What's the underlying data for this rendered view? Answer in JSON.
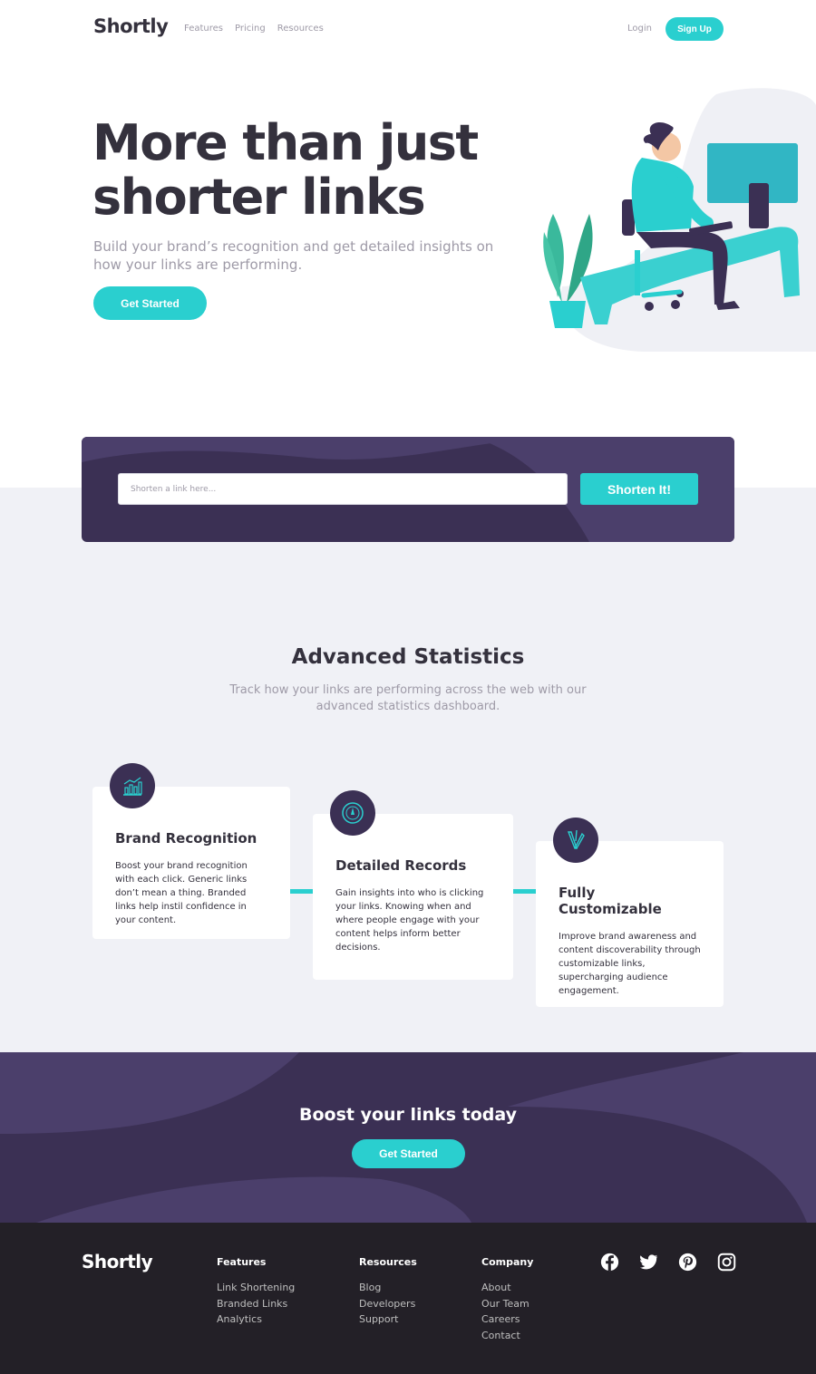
{
  "nav": {
    "logo": "Shortly",
    "links": [
      "Features",
      "Pricing",
      "Resources"
    ],
    "login": "Login",
    "signup": "Sign Up"
  },
  "hero": {
    "title_line1": "More than just",
    "title_line2": "shorter links",
    "subtitle": "Build your brand’s recognition and get detailed insights on how your links are performing.",
    "cta": "Get Started",
    "illustration": "person-working-at-desk-illustration"
  },
  "shorten": {
    "placeholder": "Shorten a link here...",
    "button": "Shorten It!"
  },
  "stats": {
    "title": "Advanced Statistics",
    "subtitle": "Track how your links are performing across the web with our advanced statistics dashboard.",
    "cards": [
      {
        "icon": "chart-icon",
        "title": "Brand Recognition",
        "text": "Boost your brand recognition with each click. Generic links don’t mean a thing. Branded links help instil confidence in your content."
      },
      {
        "icon": "gauge-icon",
        "title": "Detailed Records",
        "text": "Gain insights into who is clicking your links. Knowing when and where people engage with your content helps inform better decisions."
      },
      {
        "icon": "brushes-icon",
        "title": "Fully Customizable",
        "text": "Improve brand awareness and content discoverability through customizable links, supercharging audience engagement."
      }
    ]
  },
  "boost": {
    "title": "Boost your links today",
    "cta": "Get Started"
  },
  "footer": {
    "logo": "Shortly",
    "columns": [
      {
        "heading": "Features",
        "links": [
          "Link Shortening",
          "Branded Links",
          "Analytics"
        ]
      },
      {
        "heading": "Resources",
        "links": [
          "Blog",
          "Developers",
          "Support"
        ]
      },
      {
        "heading": "Company",
        "links": [
          "About",
          "Our Team",
          "Careers",
          "Contact"
        ]
      }
    ],
    "socials": [
      "facebook-icon",
      "twitter-icon",
      "pinterest-icon",
      "instagram-icon"
    ]
  },
  "colors": {
    "cyan": "#2acfcf",
    "dark_violet": "#3b3054",
    "grey_bg": "#f0f1f6",
    "footer_bg": "#232027"
  }
}
